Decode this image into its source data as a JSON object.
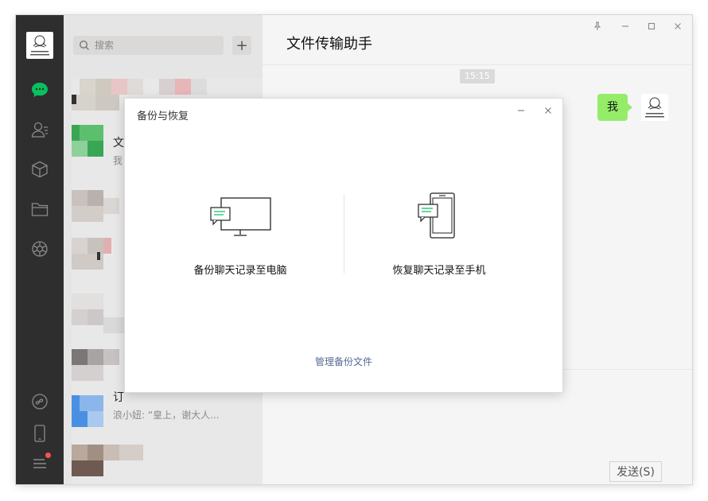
{
  "search": {
    "placeholder": "搜索"
  },
  "add_label": "+",
  "chat_list": [
    {
      "name": "文",
      "preview": "我"
    },
    {
      "name": "订",
      "preview": "浪小妞: “皇上，谢大人..."
    }
  ],
  "main": {
    "title": "文件传输助手",
    "time": "15:15",
    "message": "我",
    "send_label": "发送(S)"
  },
  "dialog": {
    "title": "备份与恢复",
    "option_backup": "备份聊天记录至电脑",
    "option_restore": "恢复聊天记录至手机",
    "manage_link": "管理备份文件"
  },
  "colors": {
    "sidebar": "#2e2e2e",
    "accent_green": "#07c160",
    "bubble": "#95ec69",
    "link": "#576b95"
  }
}
